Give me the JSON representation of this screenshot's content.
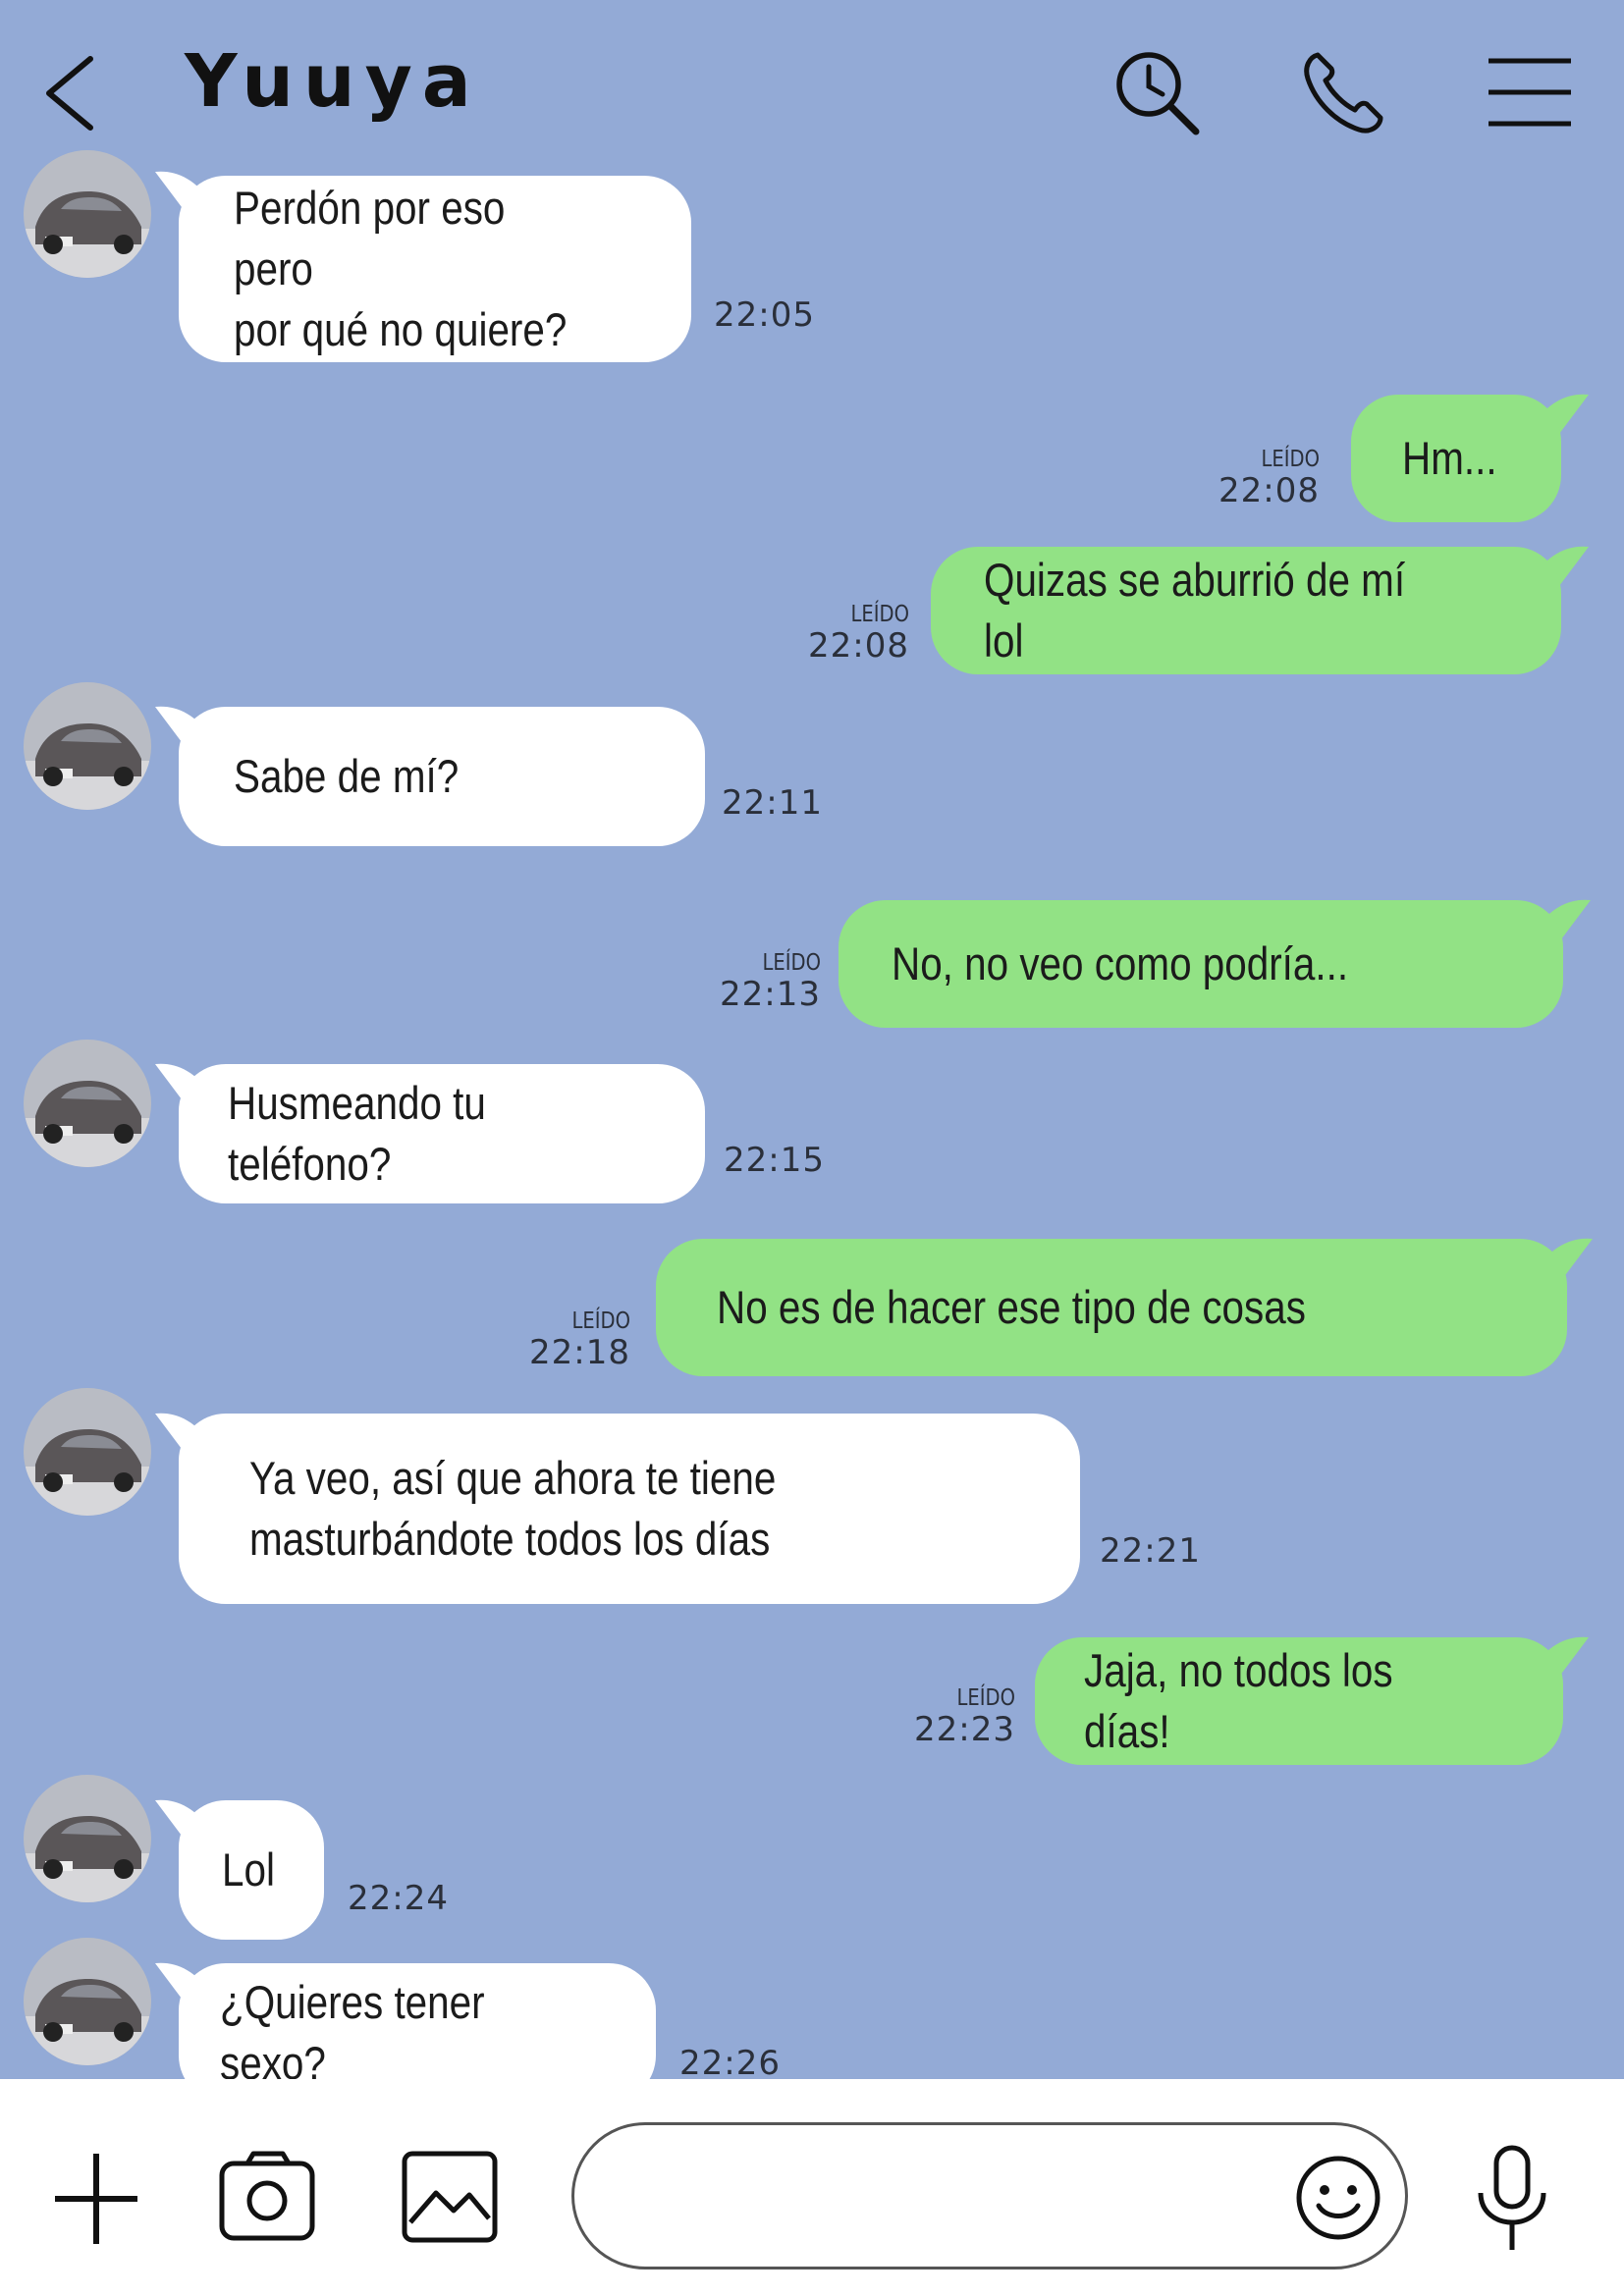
{
  "header": {
    "title": "Yuuya",
    "icons": [
      "back-arrow-icon",
      "search-history-icon",
      "phone-icon",
      "menu-icon"
    ]
  },
  "messages": [
    {
      "side": "in",
      "text": "Perdón por eso pero\npor qué no quiere?",
      "time": "22:05"
    },
    {
      "side": "out",
      "text": "Hm...",
      "time": "22:08",
      "status": "LEÍDO"
    },
    {
      "side": "out",
      "text": "Quizas se aburrió de mí lol",
      "time": "22:08",
      "status": "LEÍDO"
    },
    {
      "side": "in",
      "text": "Sabe de mí?",
      "time": "22:11"
    },
    {
      "side": "out",
      "text": "No, no veo como podría...",
      "time": "22:13",
      "status": "LEÍDO"
    },
    {
      "side": "in",
      "text": "Husmeando tu teléfono?",
      "time": "22:15"
    },
    {
      "side": "out",
      "text": "No es de hacer ese tipo de cosas",
      "time": "22:18",
      "status": "LEÍDO"
    },
    {
      "side": "in",
      "text": "Ya veo, así que ahora te tiene\nmasturbándote todos los días",
      "time": "22:21"
    },
    {
      "side": "out",
      "text": "Jaja, no todos los días!",
      "time": "22:23",
      "status": "LEÍDO"
    },
    {
      "side": "in",
      "text": "Lol",
      "time": "22:24"
    },
    {
      "side": "in",
      "text": "¿Quieres tener sexo?",
      "time": "22:26"
    }
  ],
  "composer": {
    "input_value": "",
    "icons": [
      "plus-icon",
      "camera-icon",
      "image-icon",
      "emoji-icon",
      "microphone-icon"
    ]
  },
  "colors": {
    "background": "#93aad6",
    "incoming_bubble": "#ffffff",
    "outgoing_bubble": "#92e285",
    "composer_bg": "#ffffff"
  }
}
